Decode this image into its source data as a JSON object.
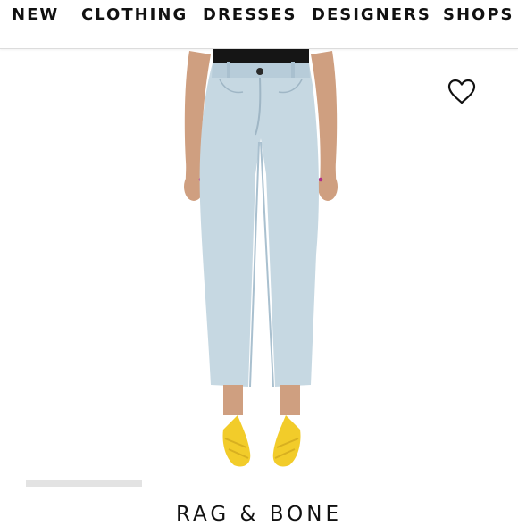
{
  "nav": {
    "items": [
      {
        "label": "NEW"
      },
      {
        "label": "CLOTHING"
      },
      {
        "label": "DRESSES"
      },
      {
        "label": "DESIGNERS"
      },
      {
        "label": "SHOPS"
      }
    ]
  },
  "product": {
    "brand": "RAG & BONE",
    "wishlist_icon": "heart-outline-icon",
    "colors": {
      "denim": "#c6d8e2",
      "denim_shadow": "#a9c0cf",
      "skin": "#cf9f80",
      "heels": "#f2cc2a",
      "top": "#151515",
      "nails": "#b0308a"
    }
  }
}
